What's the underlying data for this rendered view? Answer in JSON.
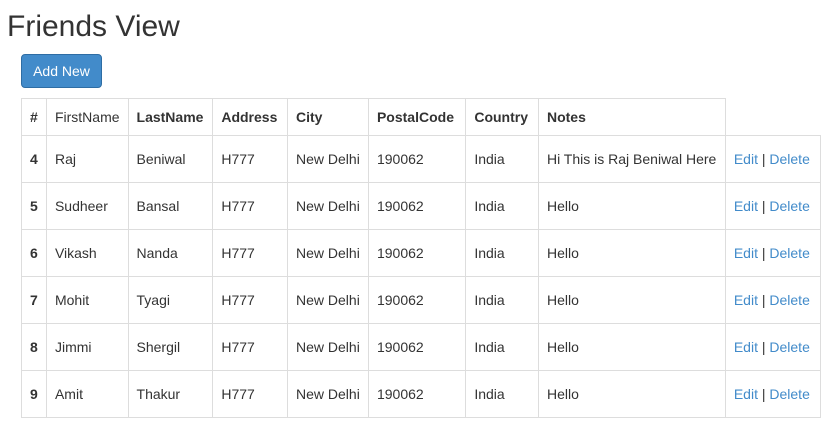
{
  "page": {
    "title": "Friends View",
    "add_new_label": "Add New"
  },
  "colors": {
    "button_bg": "#428bca",
    "link": "#428bca",
    "border": "#dddddd",
    "text": "#333333"
  },
  "table": {
    "headers": [
      "#",
      "FirstName",
      "LastName",
      "Address",
      "City",
      "PostalCode",
      "Country",
      "Notes"
    ],
    "edit_label": "Edit",
    "delete_label": "Delete",
    "separator": "|",
    "rows": [
      {
        "id": "4",
        "first": "Raj",
        "last": "Beniwal",
        "address": "H777",
        "city": "New Delhi",
        "postal": "190062",
        "country": "India",
        "notes": "Hi This is Raj Beniwal Here"
      },
      {
        "id": "5",
        "first": "Sudheer",
        "last": "Bansal",
        "address": "H777",
        "city": "New Delhi",
        "postal": "190062",
        "country": "India",
        "notes": "Hello"
      },
      {
        "id": "6",
        "first": "Vikash",
        "last": "Nanda",
        "address": "H777",
        "city": "New Delhi",
        "postal": "190062",
        "country": "India",
        "notes": "Hello"
      },
      {
        "id": "7",
        "first": "Mohit",
        "last": "Tyagi",
        "address": "H777",
        "city": "New Delhi",
        "postal": "190062",
        "country": "India",
        "notes": "Hello"
      },
      {
        "id": "8",
        "first": "Jimmi",
        "last": "Shergil",
        "address": "H777",
        "city": "New Delhi",
        "postal": "190062",
        "country": "India",
        "notes": "Hello"
      },
      {
        "id": "9",
        "first": "Amit",
        "last": "Thakur",
        "address": "H777",
        "city": "New Delhi",
        "postal": "190062",
        "country": "India",
        "notes": "Hello"
      }
    ]
  }
}
